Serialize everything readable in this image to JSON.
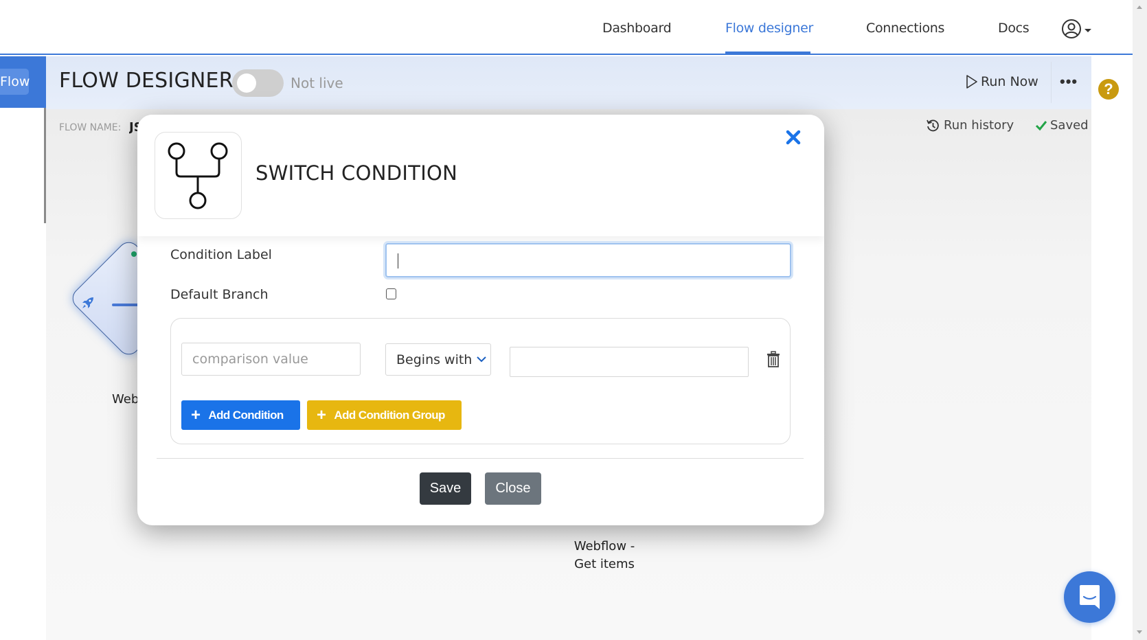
{
  "nav": {
    "items": [
      {
        "label": "Dashboard",
        "active": false
      },
      {
        "label": "Flow designer",
        "active": true
      },
      {
        "label": "Connections",
        "active": false
      },
      {
        "label": "Docs",
        "active": false
      }
    ],
    "user_icon": "user-circle-icon",
    "accent_color": "#3c78d8"
  },
  "sidebar": {
    "button_label": "Flow"
  },
  "header": {
    "title": "FLOW DESIGNER",
    "live_toggle": {
      "on": false,
      "label": "Not live"
    },
    "run_now_label": "Run Now",
    "more_label": "•••",
    "help_label": "?"
  },
  "subheader": {
    "flow_name_label": "FLOW NAME:",
    "flow_name_value": "JS",
    "run_history_label": "Run history",
    "saved_label": "Saved"
  },
  "canvas": {
    "nodes": [
      {
        "label": "Web",
        "icon": "rocket-icon"
      },
      {
        "label_line1": "Webflow -",
        "label_line2": "Get items"
      }
    ]
  },
  "modal": {
    "title": "SWITCH CONDITION",
    "icon": "switch-branch-icon",
    "fields": {
      "condition_label": {
        "label": "Condition Label",
        "value": ""
      },
      "default_branch": {
        "label": "Default Branch",
        "checked": false
      }
    },
    "condition_row": {
      "comparison_placeholder": "comparison value",
      "operator": "Begins with",
      "value": ""
    },
    "buttons": {
      "add_condition": "Add Condition",
      "add_condition_group": "Add Condition Group",
      "save": "Save",
      "close": "Close"
    },
    "colors": {
      "add_condition": "#1a73e8",
      "add_condition_group": "#e7b710",
      "save": "#343a40",
      "close": "#6c757d"
    }
  }
}
